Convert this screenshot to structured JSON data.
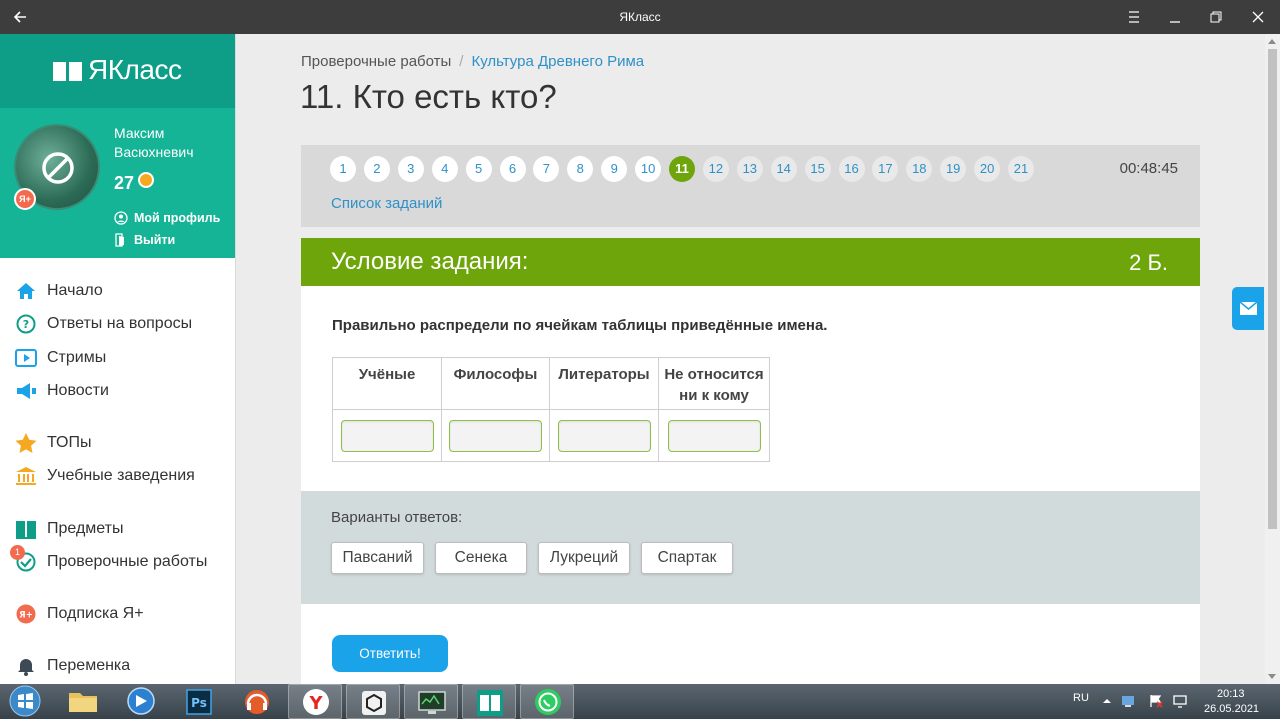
{
  "window": {
    "title": "ЯКласс"
  },
  "sidebar": {
    "logo": "ЯКласс",
    "user": {
      "first_name": "Максим",
      "last_name": "Васюхневич",
      "score": "27",
      "plus_badge": "Я+"
    },
    "profile_link": "Мой профиль",
    "logout_link": "Выйти",
    "nav": [
      {
        "label": "Начало",
        "icon": "home-icon"
      },
      {
        "label": "Ответы на вопросы",
        "icon": "question-icon"
      },
      {
        "label": "Стримы",
        "icon": "play-icon"
      },
      {
        "label": "Новости",
        "icon": "megaphone-icon"
      },
      {
        "label": "ТОПы",
        "icon": "star-icon"
      },
      {
        "label": "Учебные заведения",
        "icon": "building-icon"
      },
      {
        "label": "Предметы",
        "icon": "books-icon"
      },
      {
        "label": "Проверочные работы",
        "icon": "check-icon",
        "badge": "1"
      },
      {
        "label": "Подписка Я+",
        "icon": "subscription-icon"
      },
      {
        "label": "Переменка",
        "icon": "bell-icon"
      }
    ]
  },
  "breadcrumb": {
    "parent": "Проверочные работы",
    "separator": "/",
    "current": "Культура Древнего Рима"
  },
  "page_title": "11. Кто есть кто?",
  "questions": {
    "numbers": [
      "1",
      "2",
      "3",
      "4",
      "5",
      "6",
      "7",
      "8",
      "9",
      "10",
      "11",
      "12",
      "13",
      "14",
      "15",
      "16",
      "17",
      "18",
      "19",
      "20",
      "21"
    ],
    "active": "11",
    "timer": "00:48:45",
    "list_link": "Список заданий"
  },
  "task": {
    "header": "Условие задания:",
    "points": "2 Б.",
    "prompt": "Правильно распредели по ячейкам таблицы приведённые имена.",
    "columns": [
      "Учёные",
      "Философы",
      "Литераторы",
      "Не относится",
      "ни к кому"
    ]
  },
  "answers": {
    "label": "Варианты ответов:",
    "options": [
      "Павсаний",
      "Сенека",
      "Лукреций",
      "Спартак"
    ]
  },
  "submit_label": "Ответить!",
  "taskbar": {
    "lang": "RU",
    "time": "20:13",
    "date": "26.05.2021"
  },
  "colors": {
    "brand_green": "#6ea50a",
    "sidebar_teal": "#15b497",
    "link_blue": "#2f91c7",
    "button_blue": "#1aa3e8"
  }
}
